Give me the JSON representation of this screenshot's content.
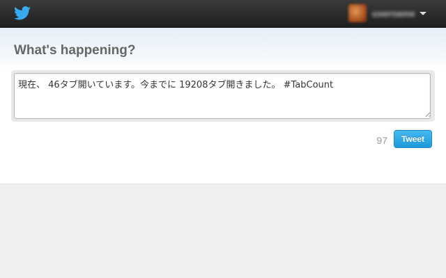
{
  "topbar": {
    "logo_icon": "twitter-bird-icon",
    "account": {
      "avatar_icon": "user-avatar",
      "username": "username",
      "menu_icon": "caret-down-icon"
    }
  },
  "compose": {
    "title": "What's happening?",
    "text": "現在、 46タブ開いています。今までに 19208タブ開きました。 #TabCount",
    "remaining_chars": "97",
    "tweet_label": "Tweet"
  },
  "colors": {
    "topbar": "#262626",
    "title": "#666666",
    "tweet_button": "#2fa9e6",
    "counter": "#999999"
  }
}
